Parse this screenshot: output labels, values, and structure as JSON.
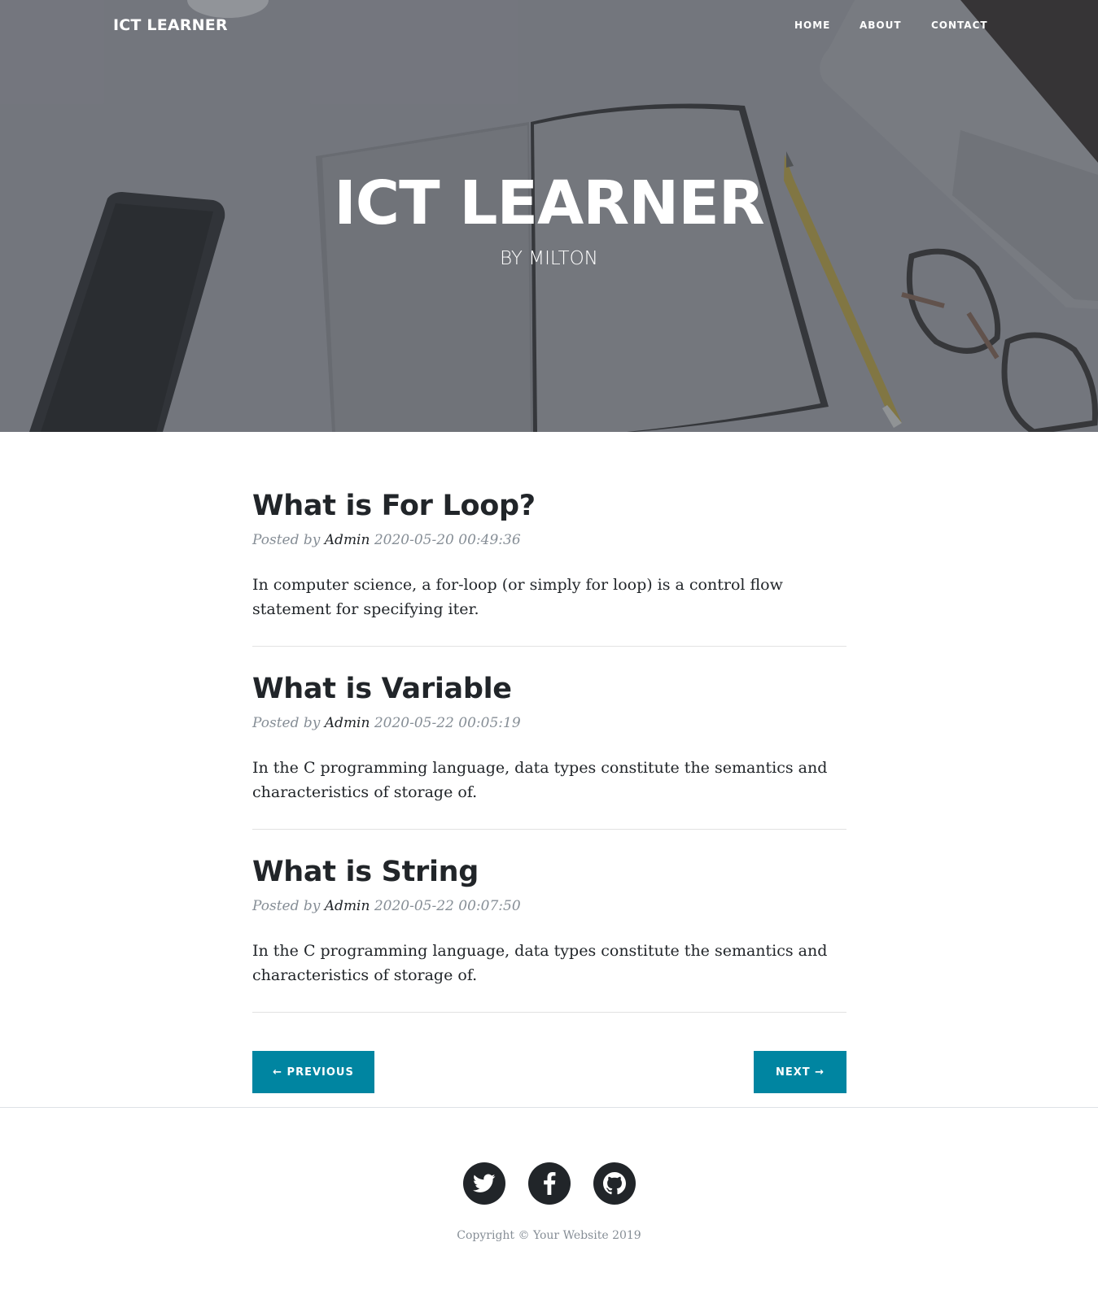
{
  "nav": {
    "brand": "ICT LEARNER",
    "links": [
      {
        "label": "HOME"
      },
      {
        "label": "ABOUT"
      },
      {
        "label": "CONTACT"
      }
    ]
  },
  "hero": {
    "title": "ICT LEARNER",
    "subtitle": "BY MILTON"
  },
  "posts": [
    {
      "title": "What is For Loop?",
      "posted_by": "Posted by",
      "author": "Admin",
      "date": "2020-05-20 00:49:36",
      "excerpt": "In computer science, a for-loop (or simply for loop) is a control flow statement for specifying iter."
    },
    {
      "title": "What is Variable",
      "posted_by": "Posted by",
      "author": "Admin",
      "date": "2020-05-22 00:05:19",
      "excerpt": "In the C programming language, data types constitute the semantics and characteristics of storage of."
    },
    {
      "title": "What is String",
      "posted_by": "Posted by",
      "author": "Admin",
      "date": "2020-05-22 00:07:50",
      "excerpt": "In the C programming language, data types constitute the semantics and characteristics of storage of."
    }
  ],
  "pager": {
    "previous": "← PREVIOUS",
    "next": "NEXT →"
  },
  "footer": {
    "social": [
      {
        "icon": "twitter-icon"
      },
      {
        "icon": "facebook-icon"
      },
      {
        "icon": "github-icon"
      }
    ],
    "copyright": "Copyright © Your Website 2019"
  },
  "colors": {
    "accent": "#0085a1",
    "text": "#212529",
    "muted": "#868e96"
  }
}
